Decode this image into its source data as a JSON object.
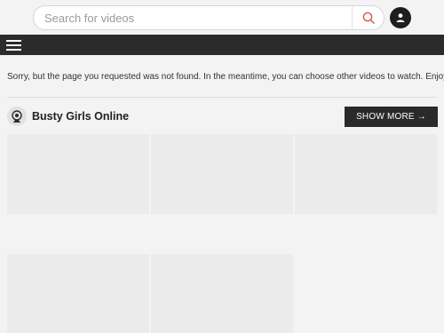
{
  "header": {
    "search": {
      "placeholder": "Search for videos",
      "value": ""
    },
    "search_button_icon": "search-icon",
    "user_icon": "user-icon",
    "accent_color": "#d9534f"
  },
  "nav": {
    "menu_icon": "hamburger-menu-icon"
  },
  "notice": {
    "text": "Sorry, but the page you requested was not found. In the meantime, you can choose other videos to watch. Enjoy!"
  },
  "section": {
    "icon": "webcam-icon",
    "title": "Busty Girls Online",
    "show_more_label": "SHOW MORE →"
  },
  "videos": [
    {
      "placeholder": true
    },
    {
      "placeholder": true
    },
    {
      "placeholder": true
    },
    {
      "placeholder": true
    },
    {
      "placeholder": true
    }
  ]
}
